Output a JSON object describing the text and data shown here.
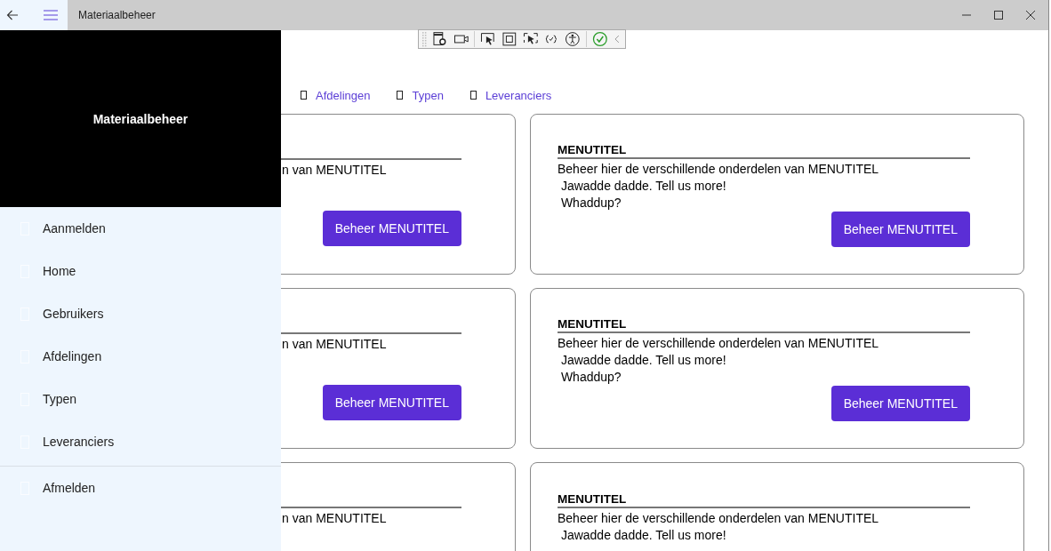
{
  "window": {
    "title": "Materiaalbeheer"
  },
  "sidebar": {
    "title": "Materiaalbeheer",
    "items": [
      {
        "label": "Aanmelden"
      },
      {
        "label": "Home"
      },
      {
        "label": "Gebruikers"
      },
      {
        "label": "Afdelingen"
      },
      {
        "label": "Typen"
      },
      {
        "label": "Leveranciers"
      }
    ],
    "footer_items": [
      {
        "label": "Afmelden"
      }
    ]
  },
  "nav_links": [
    "Afdelingen",
    "Typen",
    "Leveranciers"
  ],
  "card_rows": [
    {
      "left": {
        "lines": [
          "n van MENUTITEL"
        ],
        "button": "Beheer MENUTITEL"
      },
      "right": {
        "heading": "MENUTITEL",
        "lines": [
          "Beheer hier de verschillende onderdelen van MENUTITEL",
          " Jawadde dadde. Tell us more!",
          " Whaddup?"
        ],
        "button": "Beheer MENUTITEL"
      }
    },
    {
      "left": {
        "lines": [
          "n van MENUTITEL"
        ],
        "button": "Beheer MENUTITEL"
      },
      "right": {
        "heading": "MENUTITEL",
        "lines": [
          "Beheer hier de verschillende onderdelen van MENUTITEL",
          " Jawadde dadde. Tell us more!",
          " Whaddup?"
        ],
        "button": "Beheer MENUTITEL"
      }
    },
    {
      "left": {
        "lines": [
          "n van MENUTITEL"
        ]
      },
      "right": {
        "heading": "MENUTITEL",
        "lines": [
          "Beheer hier de verschillende onderdelen van MENUTITEL",
          " Jawadde dadde. Tell us more!"
        ]
      }
    }
  ]
}
